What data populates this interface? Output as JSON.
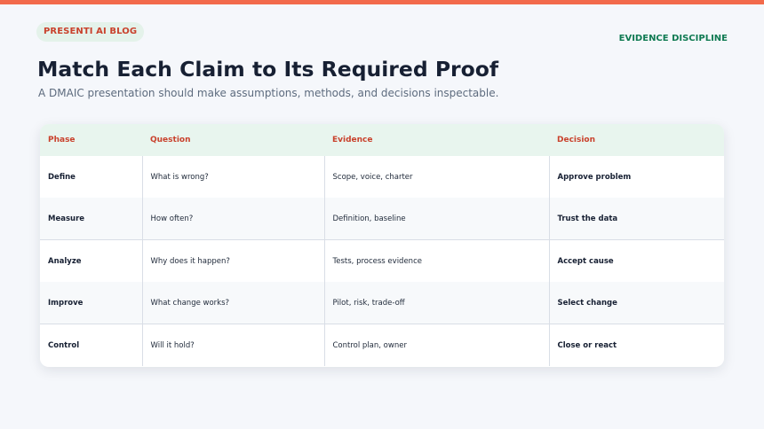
{
  "colors": {
    "accent_bar": "#f26a4b",
    "badge_bg": "#e4f2ea",
    "badge_text": "#c9412c",
    "tag_text": "#0f7a52",
    "header_bg": "#e8f5ee",
    "header_text": "#c9412c"
  },
  "badge": "PRESENTI AI BLOG",
  "tag": "EVIDENCE DISCIPLINE",
  "title": "Match Each Claim to Its Required Proof",
  "subtitle": "A DMAIC presentation should make assumptions, methods, and decisions inspectable.",
  "table": {
    "headers": [
      "Phase",
      "Question",
      "Evidence",
      "Decision"
    ],
    "rows": [
      {
        "phase": "Define",
        "question": "What is wrong?",
        "evidence": "Scope, voice, charter",
        "decision": "Approve problem"
      },
      {
        "phase": "Measure",
        "question": "How often?",
        "evidence": "Definition, baseline",
        "decision": "Trust the data"
      },
      {
        "phase": "Analyze",
        "question": "Why does it happen?",
        "evidence": "Tests, process evidence",
        "decision": "Accept cause"
      },
      {
        "phase": "Improve",
        "question": "What change works?",
        "evidence": "Pilot, risk, trade-off",
        "decision": "Select change"
      },
      {
        "phase": "Control",
        "question": "Will it hold?",
        "evidence": "Control plan, owner",
        "decision": "Close or react"
      }
    ]
  }
}
